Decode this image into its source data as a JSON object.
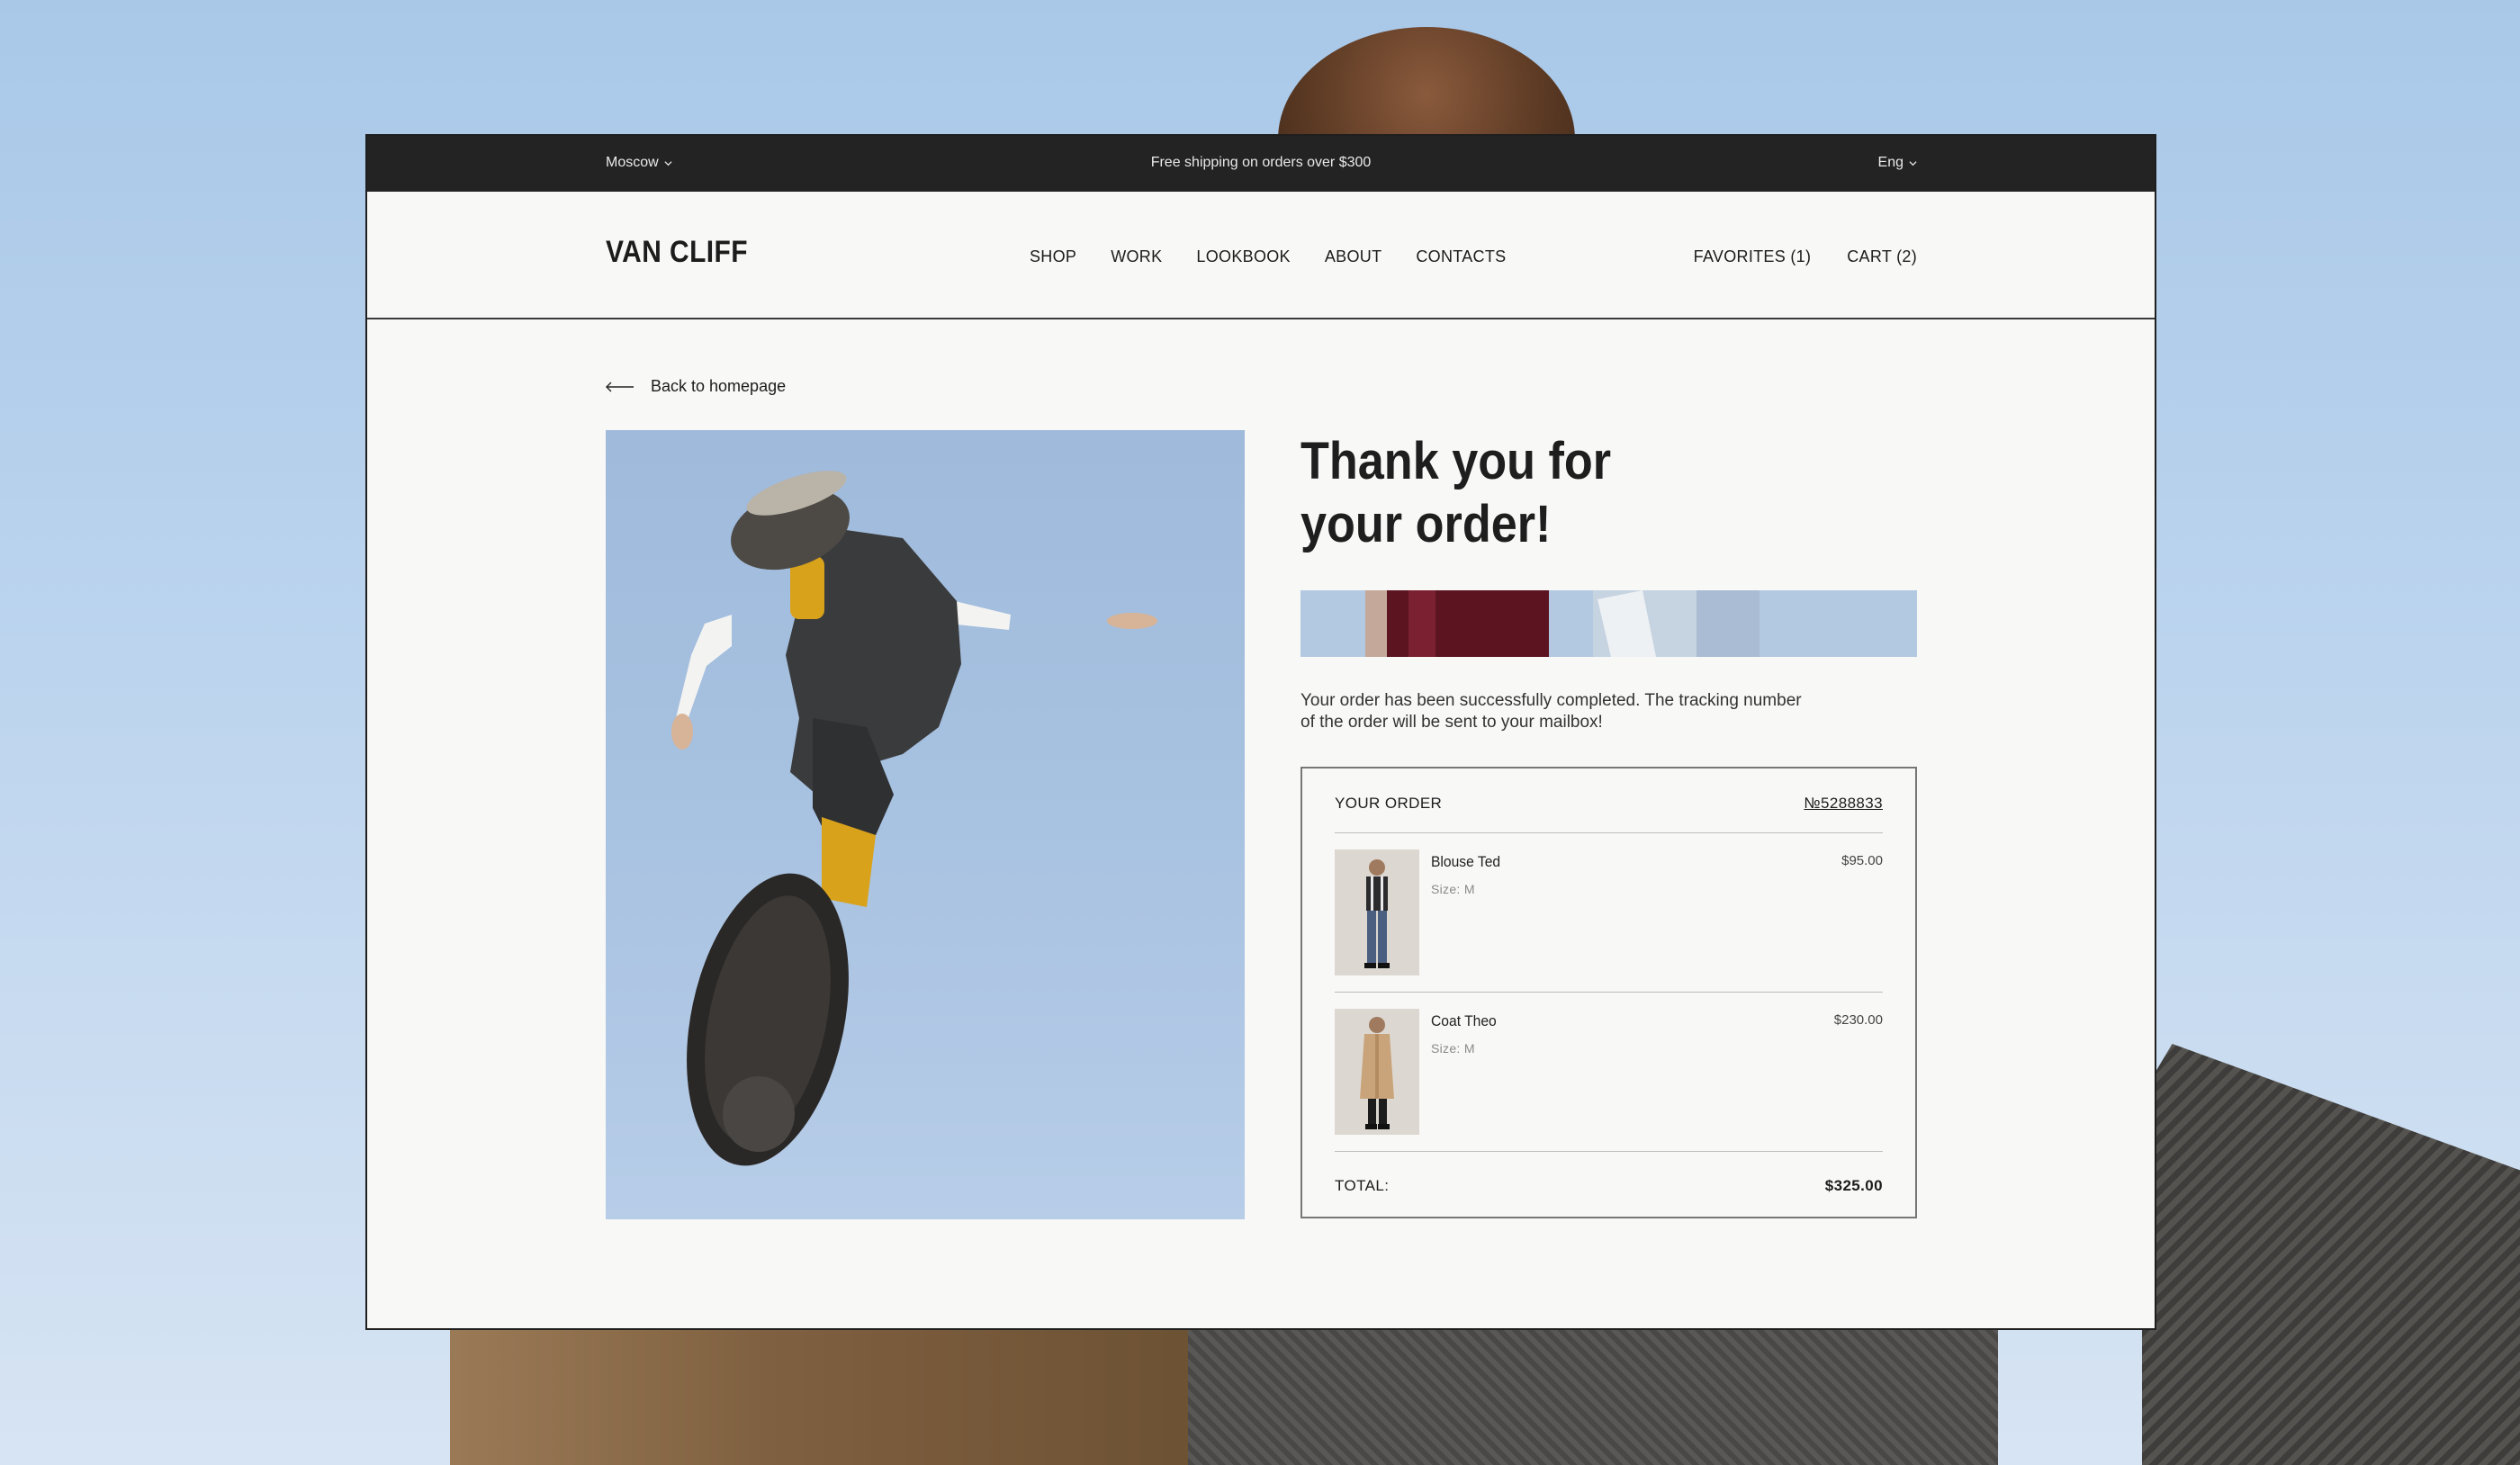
{
  "topbar": {
    "city": "Moscow",
    "promo": "Free shipping on orders over $300",
    "language": "Eng"
  },
  "header": {
    "logo": "VAN CLIFF",
    "nav": [
      "SHOP",
      "WORK",
      "LOOKBOOK",
      "ABOUT",
      "CONTACTS"
    ],
    "favorites": "FAVORITES (1)",
    "cart": "CART (2)"
  },
  "page": {
    "back_link": "Back to homepage",
    "title_line1": "Thank you for",
    "title_line2": "your order!",
    "message": "Your order has been successfully completed. The tracking number of the order will be sent to your mailbox!"
  },
  "order": {
    "heading": "YOUR ORDER",
    "number": "№5288833",
    "items": [
      {
        "name": "Blouse Ted",
        "size": "Size:  M",
        "price": "$95.00"
      },
      {
        "name": "Coat Theo",
        "size": "Size:  M",
        "price": "$230.00"
      }
    ],
    "total_label": "TOTAL:",
    "total_value": "$325.00"
  },
  "colors": {
    "topbar_bg": "#232323",
    "page_bg": "#f8f8f7",
    "sky": "#a8c2e1",
    "sock_yellow": "#d9a21b"
  }
}
